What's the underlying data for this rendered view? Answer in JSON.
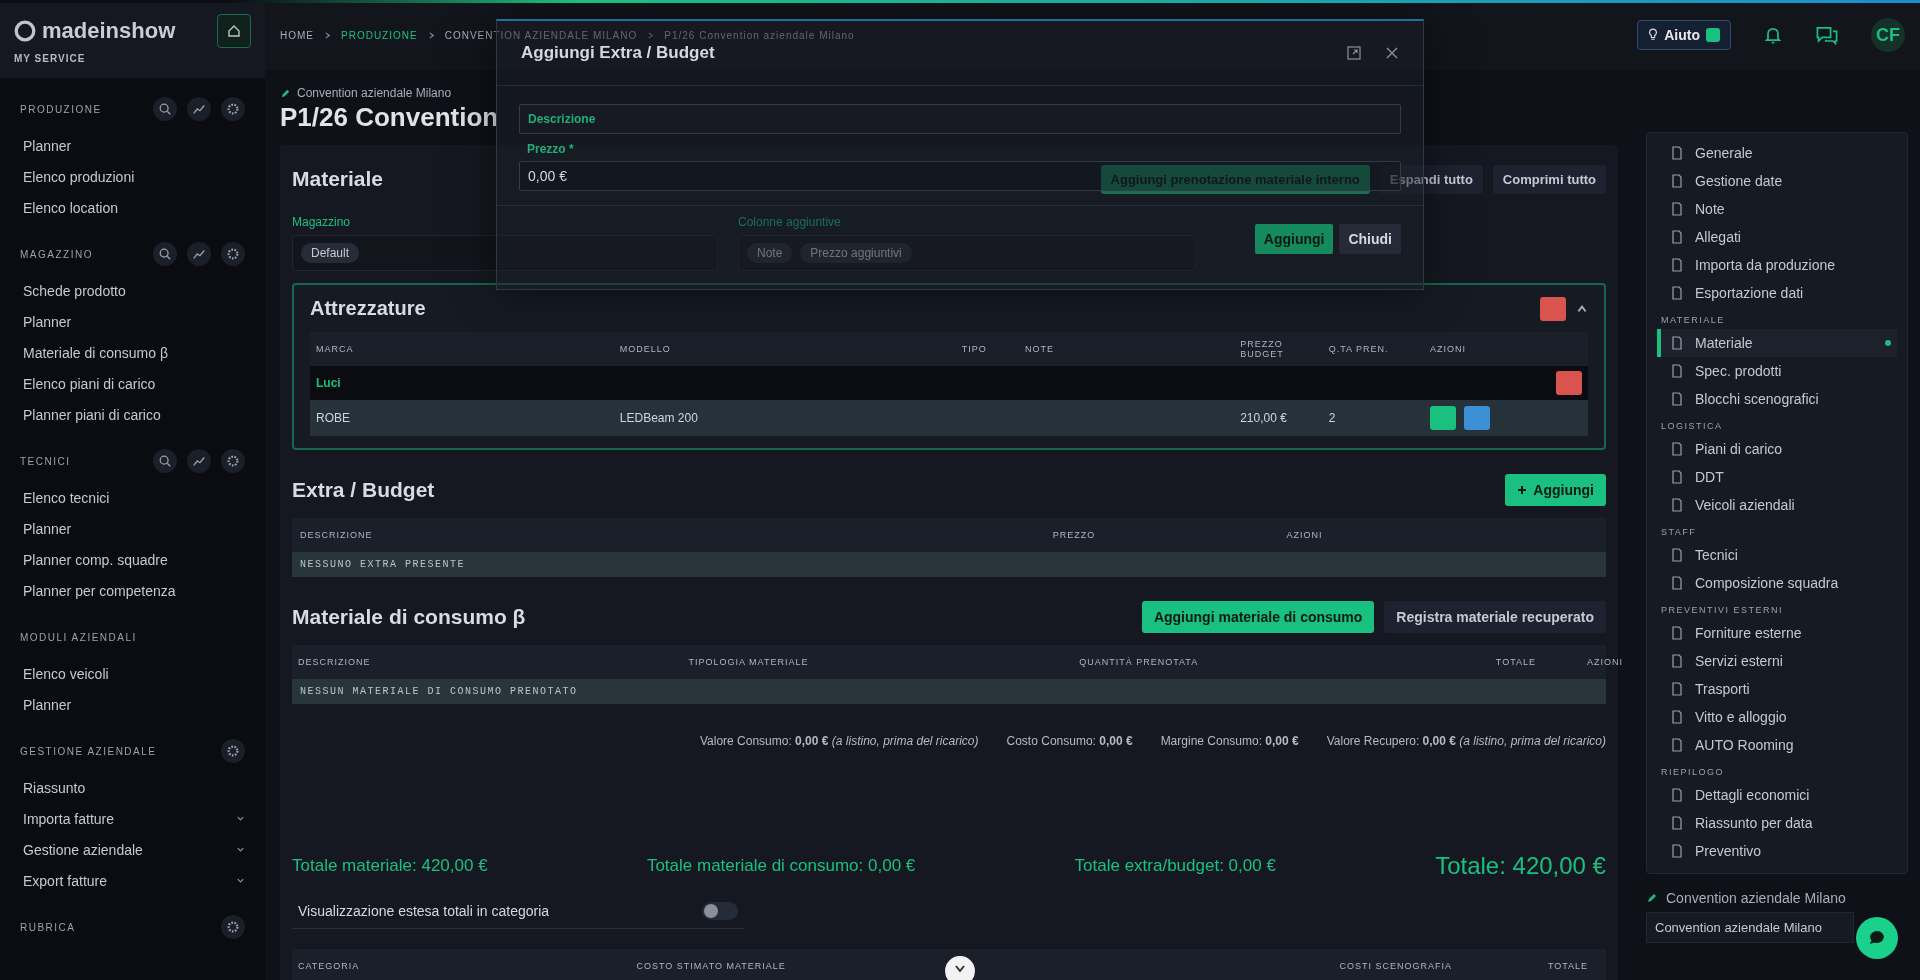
{
  "sidebar": {
    "logo": "madeinshow",
    "subtitle": "MY SERVICE",
    "sections": [
      {
        "title": "PRODUZIONE",
        "tools": true,
        "settings": true,
        "items": [
          {
            "label": "Planner",
            "expandable": false
          },
          {
            "label": "Elenco produzioni",
            "expandable": false
          },
          {
            "label": "Elenco location",
            "expandable": false
          }
        ]
      },
      {
        "title": "MAGAZZINO",
        "tools": true,
        "settings": true,
        "items": [
          {
            "label": "Schede prodotto",
            "expandable": false
          },
          {
            "label": "Planner",
            "expandable": false
          },
          {
            "label": "Materiale di consumo β",
            "expandable": false
          },
          {
            "label": "Elenco piani di carico",
            "expandable": false
          },
          {
            "label": "Planner piani di carico",
            "expandable": false
          }
        ]
      },
      {
        "title": "TECNICI",
        "tools": true,
        "settings": true,
        "items": [
          {
            "label": "Elenco tecnici",
            "expandable": false
          },
          {
            "label": "Planner",
            "expandable": false
          },
          {
            "label": "Planner comp. squadre",
            "expandable": false
          },
          {
            "label": "Planner per competenza",
            "expandable": false
          }
        ]
      },
      {
        "title": "MODULI AZIENDALI",
        "tools": false,
        "settings": false,
        "items": [
          {
            "label": "Elenco veicoli",
            "expandable": false
          },
          {
            "label": "Planner",
            "expandable": false
          }
        ]
      },
      {
        "title": "GESTIONE AZIENDALE",
        "tools": false,
        "settings": true,
        "items": [
          {
            "label": "Riassunto",
            "expandable": false
          },
          {
            "label": "Importa fatture",
            "expandable": true
          },
          {
            "label": "Gestione aziendale",
            "expandable": true
          },
          {
            "label": "Export fatture",
            "expandable": true
          }
        ]
      },
      {
        "title": "RUBRICA",
        "tools": false,
        "settings": true
      }
    ]
  },
  "topbar": {
    "breadcrumbs": [
      {
        "label": "HOME",
        "selected": false
      },
      {
        "label": "PRODUZIONE",
        "selected": true
      },
      {
        "label": "CONVENTION AZIENDALE MILANO",
        "selected": false
      },
      {
        "label": "P1/26 Convention aziendale Milano",
        "selected": false
      }
    ],
    "help_button": "Aiuto",
    "avatar": "CF"
  },
  "header": {
    "subtitle": "Convention aziendale Milano",
    "title": "P1/26 Convention"
  },
  "materiale": {
    "title": "Materiale",
    "buttons": [
      "Aggiungi prenotazione materiale interno",
      "Espandi tutto",
      "Comprimi tutto"
    ],
    "warehouse_label": "Magazzino",
    "warehouse_chip": "Default",
    "columns_label": "Colonne aggiuntive",
    "column_chips": [
      "Note",
      "Prezzo aggiuntivi"
    ],
    "card": {
      "title": "Attrezzature",
      "expanded": true,
      "columns": [
        "MARCA",
        "MODELLO",
        "TIPO",
        "NOTE",
        "PREZZO BUDGET",
        "Q.TA PREN.",
        "AZIONI"
      ],
      "group": "Luci",
      "rows": [
        {
          "brand": "ROBE",
          "model": "LEDBeam 200",
          "price": "210,00 €",
          "qty": "2"
        }
      ]
    }
  },
  "extra": {
    "title": "Extra / Budget",
    "add_button": "Aggiungi",
    "columns": [
      "DESCRIZIONE",
      "PREZZO",
      "AZIONI"
    ],
    "empty": "NESSUNO EXTRA PRESENTE"
  },
  "consumo": {
    "title": "Materiale di consumo β",
    "buttons": [
      "Aggiungi materiale di consumo",
      "Registra materiale recuperato"
    ],
    "columns": [
      "DESCRIZIONE",
      "TIPOLOGIA MATERIALE",
      "QUANTITÀ PRENOTATA",
      "TOTALE",
      "AZIONI"
    ],
    "empty": "NESSUN MATERIALE DI CONSUMO PRENOTATO",
    "summary": [
      "Valore Consumo: **0,00 €** *(a listino, prima del ricarico)*",
      "Costo Consumo: **0,00 €**",
      "Margine Consumo: **0,00 €**",
      "Valore Recupero: **0,00 €** *(a listino, prima del ricarico)*"
    ]
  },
  "totals": [
    "Totale materiale: 420,00 €",
    "Totale materiale di consumo: 0,00 €",
    "Totale extra/budget: 0,00 €",
    "Totale: 420,00 €"
  ],
  "extended_toggle": {
    "label": "Visualizzazione estesa totali in categoria",
    "on": false
  },
  "category_table": {
    "columns": [
      "CATEGORIA",
      "COSTO STIMATO MATERIALE",
      "COSTI SCENOGRAFIA",
      "TOTALE"
    ]
  },
  "right_nav": {
    "groups": [
      {
        "items": [
          {
            "label": "Generale",
            "selected": false
          },
          {
            "label": "Gestione date",
            "selected": false
          },
          {
            "label": "Note",
            "selected": false
          },
          {
            "label": "Allegati",
            "selected": false
          },
          {
            "label": "Importa da produzione",
            "selected": false
          },
          {
            "label": "Esportazione dati",
            "selected": false
          }
        ]
      },
      {
        "title": "MATERIALE",
        "items": [
          {
            "label": "Materiale",
            "selected": true
          },
          {
            "label": "Spec. prodotti",
            "selected": false
          },
          {
            "label": "Blocchi scenografici",
            "selected": false
          }
        ]
      },
      {
        "title": "LOGISTICA",
        "items": [
          {
            "label": "Piani di carico",
            "selected": false
          },
          {
            "label": "DDT",
            "selected": false
          },
          {
            "label": "Veicoli aziendali",
            "selected": false
          }
        ]
      },
      {
        "title": "STAFF",
        "items": [
          {
            "label": "Tecnici",
            "selected": false
          },
          {
            "label": "Composizione squadra",
            "selected": false
          }
        ]
      },
      {
        "title": "PREVENTIVI ESTERNI",
        "items": [
          {
            "label": "Forniture esterne",
            "selected": false
          },
          {
            "label": "Servizi esterni",
            "selected": false
          },
          {
            "label": "Trasporti",
            "selected": false
          },
          {
            "label": "Vitto e alloggio",
            "selected": false
          },
          {
            "label": "AUTO Rooming",
            "selected": false
          }
        ]
      },
      {
        "title": "RIEPILOGO",
        "items": [
          {
            "label": "Dettagli economici",
            "selected": false
          },
          {
            "label": "Riassunto per data",
            "selected": false
          },
          {
            "label": "Preventivo",
            "selected": false
          }
        ]
      }
    ],
    "footer_label": "Convention aziendale Milano",
    "footer_field": "Convention aziendale Milano"
  },
  "modal": {
    "title": "Aggiungi Extra / Budget",
    "fields": [
      {
        "label": "Descrizione"
      },
      {
        "label": "Prezzo *",
        "value": "0,00 €"
      }
    ],
    "buttons": [
      {
        "label": "Aggiungi",
        "kind": "primary"
      },
      {
        "label": "Chiudi",
        "kind": "secondary"
      }
    ]
  }
}
